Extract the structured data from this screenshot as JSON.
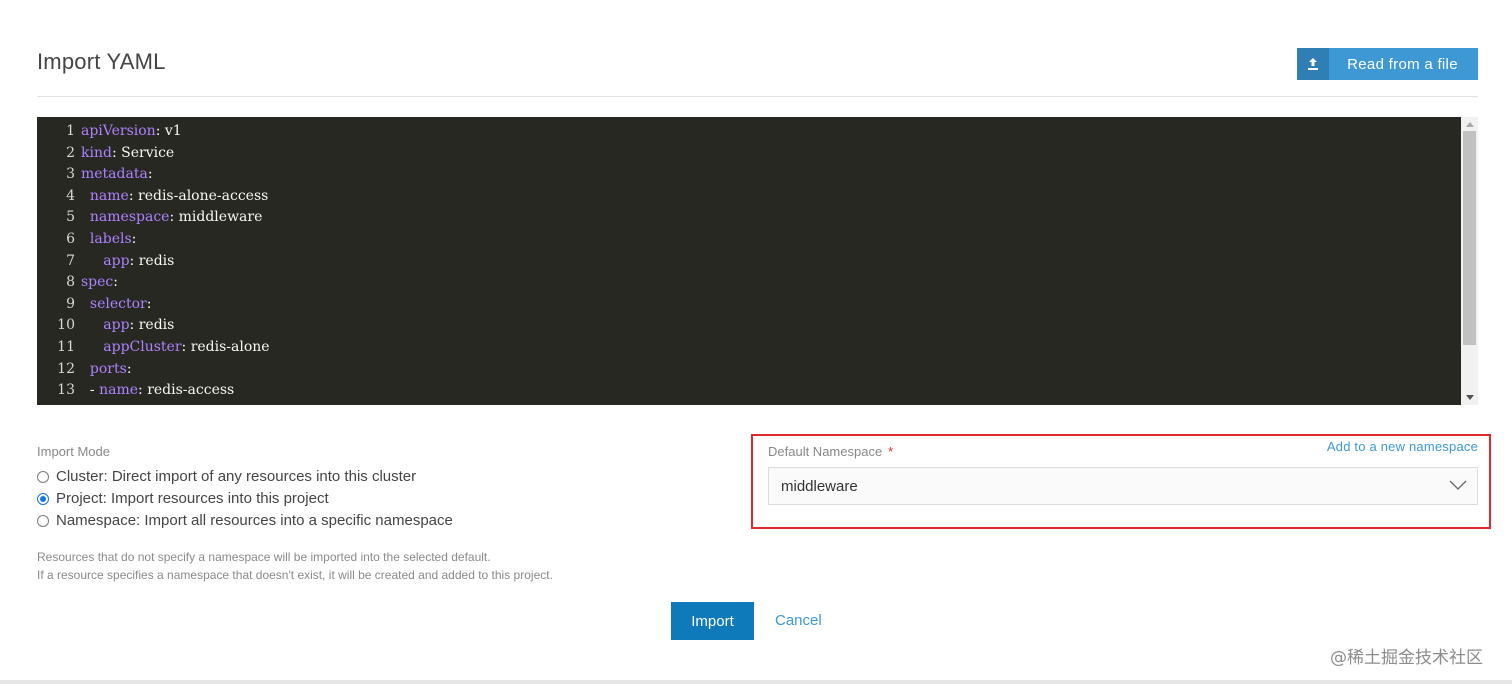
{
  "header": {
    "title": "Import YAML",
    "read_file_label": "Read from a file",
    "read_file_icon": "upload-icon"
  },
  "editor": {
    "lines": [
      {
        "n": "1",
        "indent": "",
        "key": "apiVersion",
        "sep": ": ",
        "val": "v1"
      },
      {
        "n": "2",
        "indent": "",
        "key": "kind",
        "sep": ": ",
        "val": "Service"
      },
      {
        "n": "3",
        "indent": "",
        "key": "metadata",
        "sep": ":",
        "val": ""
      },
      {
        "n": "4",
        "indent": "  ",
        "key": "name",
        "sep": ": ",
        "val": "redis-alone-access"
      },
      {
        "n": "5",
        "indent": "  ",
        "key": "namespace",
        "sep": ": ",
        "val": "middleware"
      },
      {
        "n": "6",
        "indent": "  ",
        "key": "labels",
        "sep": ":",
        "val": ""
      },
      {
        "n": "7",
        "indent": "     ",
        "key": "app",
        "sep": ": ",
        "val": "redis"
      },
      {
        "n": "8",
        "indent": "",
        "key": "spec",
        "sep": ":",
        "val": ""
      },
      {
        "n": "9",
        "indent": "  ",
        "key": "selector",
        "sep": ":",
        "val": ""
      },
      {
        "n": "10",
        "indent": "     ",
        "key": "app",
        "sep": ": ",
        "val": "redis"
      },
      {
        "n": "11",
        "indent": "     ",
        "key": "appCluster",
        "sep": ": ",
        "val": "redis-alone"
      },
      {
        "n": "12",
        "indent": "  ",
        "key": "ports",
        "sep": ":",
        "val": ""
      },
      {
        "n": "13",
        "indent": "  - ",
        "key": "name",
        "sep": ": ",
        "val": "redis-access"
      }
    ]
  },
  "import_mode": {
    "label": "Import Mode",
    "options": [
      {
        "label": "Cluster: Direct import of any resources into this cluster",
        "checked": false
      },
      {
        "label": "Project: Import resources into this project",
        "checked": true
      },
      {
        "label": "Namespace: Import all resources into a specific namespace",
        "checked": false
      }
    ]
  },
  "help": {
    "line1": "Resources that do not specify a namespace will be imported into the selected default.",
    "line2": "If a resource specifies a namespace that doesn't exist, it will be created and added to this project."
  },
  "namespace": {
    "label": "Default Namespace",
    "required_mark": "*",
    "add_link": "Add to a new namespace",
    "selected": "middleware",
    "highlight_color": "#e0282e"
  },
  "actions": {
    "import_label": "Import",
    "cancel_label": "Cancel"
  },
  "watermark": "@稀土掘金技术社区",
  "colors": {
    "accent": "#3d98d3",
    "primary_button": "#0e7ab9",
    "editor_bg": "#272822",
    "yaml_key": "#ae81ff"
  }
}
